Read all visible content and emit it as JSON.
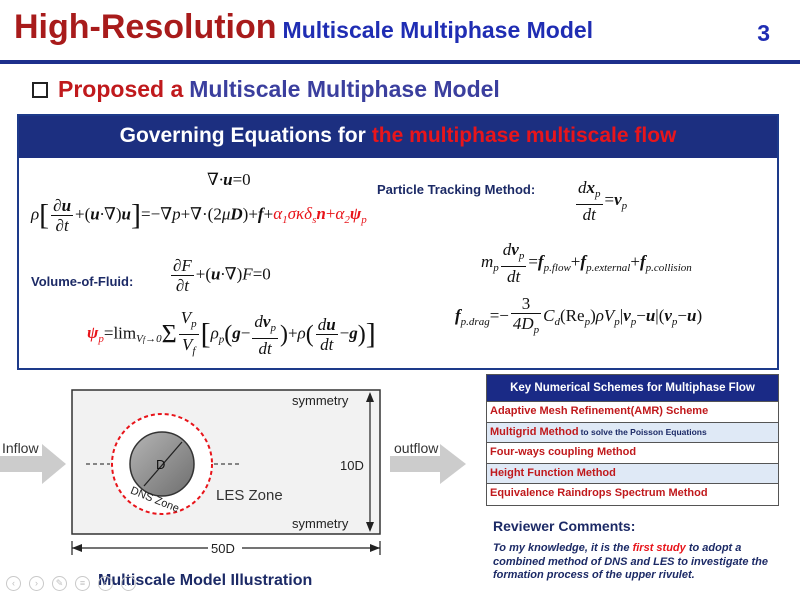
{
  "header": {
    "title_main": "High-Resolution",
    "title_sub": "Multiscale Multiphase Model",
    "slide_number": "3"
  },
  "subtitle": {
    "red": "Proposed a",
    "blue": "Multiscale Multiphase Model"
  },
  "equations_box": {
    "header_white": "Governing Equations for",
    "header_red": "the multiphase multiscale flow",
    "particle_tracking_label": "Particle Tracking Method:",
    "volume_of_fluid_label": "Volume-of-Fluid:"
  },
  "diagram": {
    "top_label": "symmetry",
    "bottom_label": "symmetry",
    "inflow": "Inflow",
    "outflow": "outflow",
    "height_label": "10D",
    "width_label": "50D",
    "particle_label": "D",
    "dns_zone": "DNS Zone",
    "les_zone": "LES Zone",
    "caption": "Multiscale Model Illustration"
  },
  "schemes": {
    "header": "Key Numerical Schemes for Multiphase Flow",
    "rows": [
      "Adaptive Mesh Refinement(AMR) Scheme",
      "Multigrid Method",
      "Four-ways coupling Method",
      "Height Function Method",
      "Equivalence Raindrops Spectrum Method"
    ],
    "multigrid_extra": "to solve the Poisson Equations"
  },
  "review": {
    "title": "Reviewer Comments:",
    "text_before": "To my knowledge, it is the",
    "highlight": "first study",
    "text_after": "to adopt a combined method of DNS and LES to investigate the formation process of the upper rivulet."
  },
  "colors": {
    "title_red": "#a81b1b",
    "title_blue": "#1f2db3",
    "header_navy": "#1c2f80",
    "accent_red": "#e8141a"
  }
}
